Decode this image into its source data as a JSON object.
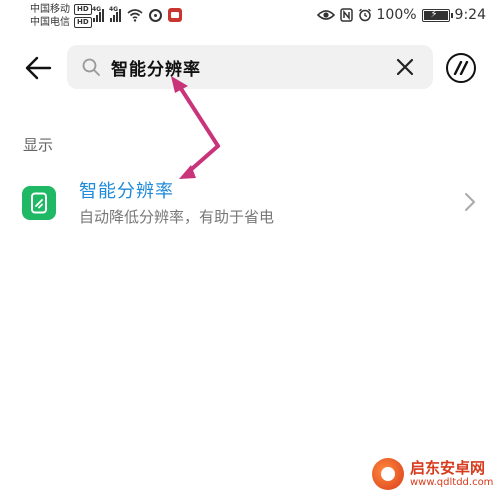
{
  "status_bar": {
    "carrier_1": "中国移动",
    "carrier_2": "中国电信",
    "hd_badge": "HD",
    "network_type": "4G",
    "battery_percent": "100%",
    "time": "9:24",
    "icons": [
      "signal-icon",
      "wifi-icon",
      "app-notification-icon",
      "eye-comfort-icon",
      "nfc-icon",
      "alarm-icon",
      "battery-icon"
    ]
  },
  "header": {
    "search_query": "智能分辨率",
    "icons": [
      "back-arrow-icon",
      "search-icon",
      "clear-icon",
      "ai-assistant-icon"
    ]
  },
  "section": {
    "label": "显示"
  },
  "result": {
    "title": "智能分辨率",
    "subtitle": "自动降低分辨率，有助于省电",
    "icon": "smart-resolution-icon",
    "accent_color": "#1e8ad9",
    "icon_color": "#1fb864"
  },
  "annotation": {
    "arrow_color": "#c8337a"
  },
  "watermark": {
    "name": "启东安卓网",
    "url": "www.qdltdd.com"
  }
}
